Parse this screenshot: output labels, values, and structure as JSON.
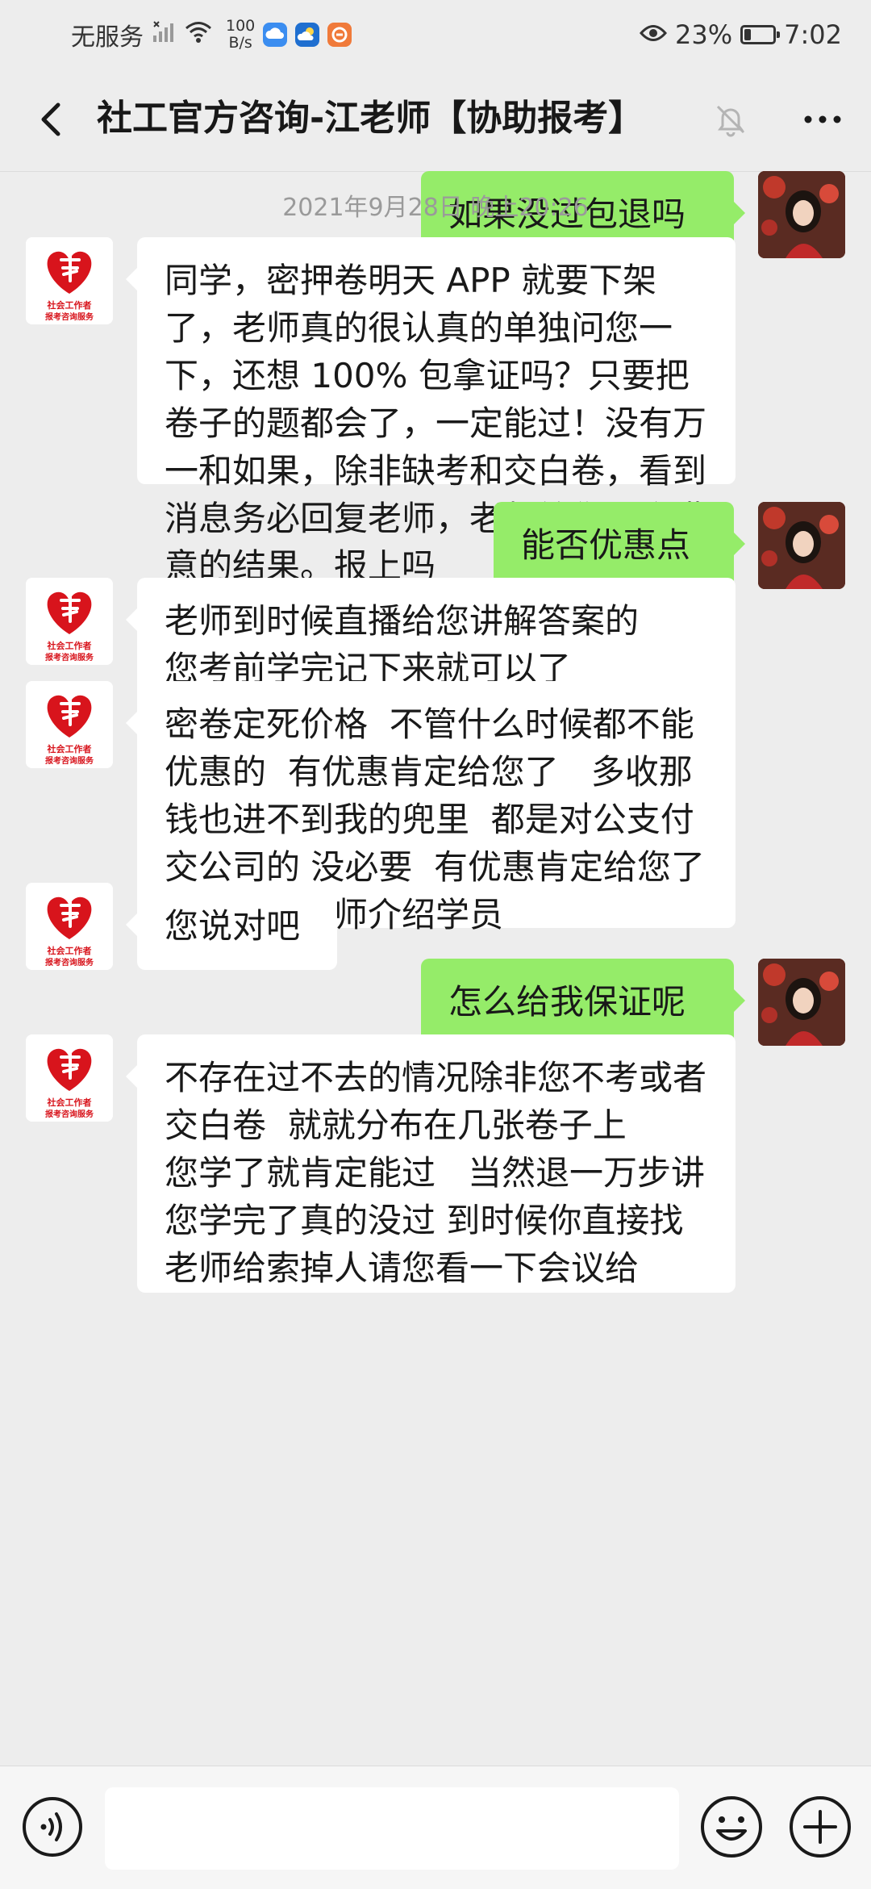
{
  "status_bar": {
    "carrier": "无服务",
    "speed_value": "100",
    "speed_unit": "B/s",
    "battery_percent": "23%",
    "battery_level": 0.23,
    "time": "7:02"
  },
  "header": {
    "title": "社工官方咨询-江老师【协助报考】"
  },
  "avatar_logo": {
    "line1": "社会工作者",
    "line2": "报考咨询服务"
  },
  "messages": [
    {
      "from": "me",
      "text": "如果没过包退吗"
    },
    {
      "type": "timestamp",
      "text": "2021年9月28日 晚上20:26"
    },
    {
      "from": "other",
      "text": "同学，密押卷明天 APP 就要下架了，老师真的很认真的单独问您一下，还想 100% 包拿证吗？只要把卷子的题都会了，一定能过！没有万一和如果，除非缺考和交白卷，看到消息务必回复老师，老师给你一个满意的结果。报上吗"
    },
    {
      "from": "me",
      "text": "能否优惠点"
    },
    {
      "from": "other",
      "text": "老师到时候直播给您讲解答案的\n您考前学完记下来就可以了"
    },
    {
      "from": "other",
      "text": "密卷定死价格  不管什么时候都不能优惠的  有优惠肯定给您了   多收那钱也进不到我的兜里  都是对公支付交公司的 没必要  有优惠肯定给您了  您还能帮老师介绍学员"
    },
    {
      "from": "other",
      "text": "您说对吧"
    },
    {
      "from": "me",
      "text": "怎么给我保证呢"
    },
    {
      "from": "other",
      "text": "不存在过不去的情况除非您不考或者交白卷  就就分布在几张卷子上\n您学了就肯定能过   当然退一万步讲您学完了真的没过 到时候你直接找老师给索掉人请您看一下会议给"
    }
  ],
  "colors": {
    "background": "#ededed",
    "my_bubble": "#95ec69",
    "other_bubble": "#ffffff",
    "logo_red": "#d8141c"
  },
  "icons": {
    "back": "chevron-left-icon",
    "mute": "bell-off-icon",
    "more": "more-dots-icon",
    "voice": "voice-icon",
    "emoji": "emoji-icon",
    "plus": "plus-circle-icon"
  }
}
